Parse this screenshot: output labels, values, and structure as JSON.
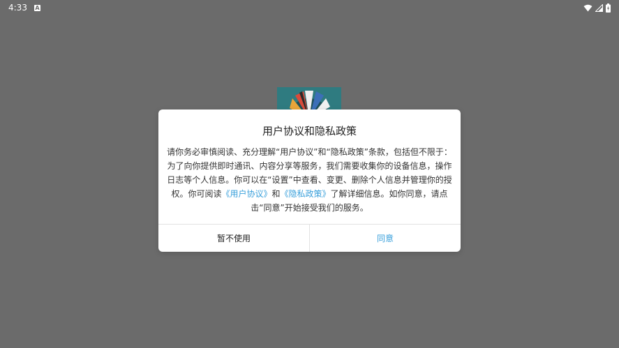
{
  "status_bar": {
    "time": "4:33",
    "notification_icon": "A"
  },
  "icons": {
    "notification": "app-notification-icon",
    "wifi": "wifi-icon",
    "signal": "cell-signal-icon",
    "battery": "battery-charging-icon"
  },
  "dialog": {
    "title": "用户协议和隐私政策",
    "body_before": "请你务必审慎阅读、充分理解“用户协议”和“隐私政策”条款，包括但不限于：为了向你提供即时通讯、内容分享等服务，我们需要收集你的设备信息，操作日志等个人信息。你可以在“设置”中查看、变更、删除个人信息并管理你的授权。你可阅读",
    "link_terms": "《用户协议》",
    "and_text": "和",
    "link_privacy": "《隐私政策》",
    "body_after": "了解详细信息。如你同意，请点击“同意”开始接受我们的服务。",
    "decline_label": "暂不使用",
    "agree_label": "同意"
  },
  "colors": {
    "background": "#6b6b6b",
    "accent": "#3aa0db",
    "logo_bg": "#2f7b80"
  }
}
